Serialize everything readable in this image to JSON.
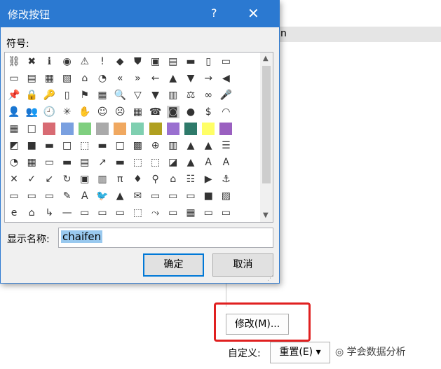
{
  "dialog": {
    "title": "修改按钮",
    "help": "?",
    "close": "✕",
    "symbol_label": "符号:",
    "name_label": "显示名称:",
    "name_value": "chaifen",
    "ok": "确定",
    "cancel": "取消"
  },
  "background": {
    "partial_text": "n",
    "modify_button": "修改(M)...",
    "customize_label": "自定义:",
    "reset_button": "重置(E) ▾",
    "watermark": "\t学会数据分析"
  },
  "symbols": [
    [
      "⛓",
      "✖",
      "ℹ",
      "◉",
      "⚠",
      "!",
      "◆",
      "⛊",
      "▣",
      "▤",
      "▬",
      "▯",
      "▭"
    ],
    [
      "▭",
      "▤",
      "▦",
      "▧",
      "⌂",
      "◔",
      "«",
      "»",
      "←",
      "▲",
      "▼",
      "→",
      "◀"
    ],
    [
      "📌",
      "🔒",
      "🔑",
      "▯",
      "⚑",
      "▦",
      "🔍",
      "▽",
      "▼",
      "▥",
      "⚖",
      "∞",
      "🎤"
    ],
    [
      "👤",
      "👥",
      "🕘",
      "✳",
      "✋",
      "☺",
      "☹",
      "▦",
      "☎",
      "◙",
      "●",
      "$",
      "◠"
    ],
    [
      "▦",
      "□",
      "■",
      "■",
      "■",
      "■",
      "■",
      "■",
      "■",
      "■",
      "■",
      "■",
      "■"
    ],
    [
      "◩",
      "■",
      "▬",
      "□",
      "⬚",
      "▬",
      "□",
      "▩",
      "⊕",
      "▥",
      "▲",
      "▲",
      "☰"
    ],
    [
      "◔",
      "▦",
      "▭",
      "▬",
      "▤",
      "↗",
      "▬",
      "⬚",
      "⬚",
      "◪",
      "▲",
      "A",
      "A"
    ],
    [
      "✕",
      "✓",
      "↙",
      "↻",
      "▣",
      "▥",
      "π",
      "♦",
      "⚲",
      "⌂",
      "☷",
      "▶",
      "⚓"
    ],
    [
      "▭",
      "▭",
      "▭",
      "✎",
      "A",
      "🐦",
      "▲",
      "✉",
      "▭",
      "▭",
      "▭",
      "■",
      "▨"
    ],
    [
      "e",
      "⌂",
      "↳",
      "—",
      "▭",
      "▭",
      "▭",
      "⬚",
      "⤳",
      "▭",
      "▦",
      "▭",
      "▭"
    ]
  ],
  "colors": {
    "titlebar": "#2b79d1",
    "highlight_box": "#e02020",
    "selection": "#99c9ef"
  }
}
